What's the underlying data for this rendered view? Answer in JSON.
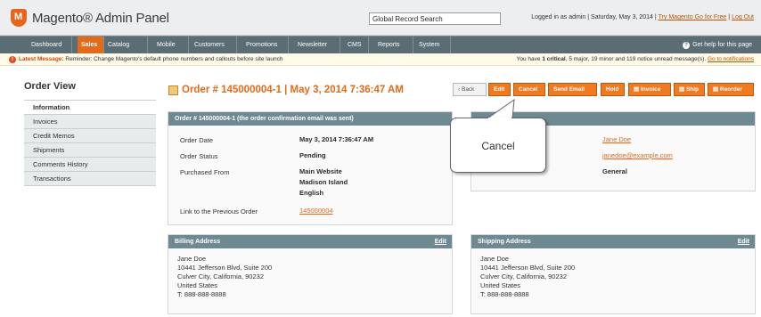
{
  "header": {
    "logo_text": "Magento® Admin Panel",
    "search_label": "Global Record Search",
    "logged_in": "Logged in as admin",
    "date": "Saturday, May 3, 2014",
    "try_link": "Try Magento Go for Free",
    "logout": "Log Out",
    "sep": "|"
  },
  "nav": {
    "items": [
      "Dashboard",
      "Sales",
      "Catalog",
      "Mobile",
      "Customers",
      "Promotions",
      "Newsletter",
      "CMS",
      "Reports",
      "System"
    ],
    "active": "Sales",
    "help": "Get help for this page"
  },
  "message": {
    "label": "Latest Message:",
    "text": "Reminder: Change Magento's default phone numbers and callouts before site launch",
    "right_prefix": "You have",
    "critical": "1 critical",
    "right_rest": ", 5 major, 19 minor and 119 notice unread message(s).",
    "link": "Go to notifications"
  },
  "sidebar": {
    "title": "Order View",
    "items": [
      "Information",
      "Invoices",
      "Credit Memos",
      "Shipments",
      "Comments History",
      "Transactions"
    ]
  },
  "page": {
    "title": "Order # 145000004-1 | May 3, 2014 7:36:47 AM"
  },
  "buttons": {
    "back": "Back",
    "edit": "Edit",
    "cancel": "Cancel",
    "send_email": "Send Email",
    "hold": "Hold",
    "invoice": "Invoice",
    "ship": "Ship",
    "reorder": "Reorder"
  },
  "order_box": {
    "title": "Order # 145000004-1 (the order confirmation email was sent)",
    "order_date_label": "Order Date",
    "order_date": "May 3, 2014 7:36:47 AM",
    "status_label": "Order Status",
    "status": "Pending",
    "purchased_label": "Purchased From",
    "purchased_1": "Main Website",
    "purchased_2": "Madison Island",
    "purchased_3": "English",
    "prev_label": "Link to the Previous Order",
    "prev_value": "145000004"
  },
  "account_box": {
    "name": "Jane Doe",
    "email": "janedoe@example.com",
    "group": "General"
  },
  "billing": {
    "title": "Billing Address",
    "edit": "Edit",
    "lines": [
      "Jane Doe",
      "10441 Jefferson Blvd, Suite 200",
      "Culver City, California, 90232",
      "United States",
      "T: 888-888-8888"
    ]
  },
  "shipping": {
    "title": "Shipping Address",
    "edit": "Edit",
    "lines": [
      "Jane Doe",
      "10441 Jefferson Blvd, Suite 200",
      "Culver City, California, 90232",
      "United States",
      "T: 888-888-8888"
    ]
  },
  "callout": {
    "text": "Cancel"
  }
}
